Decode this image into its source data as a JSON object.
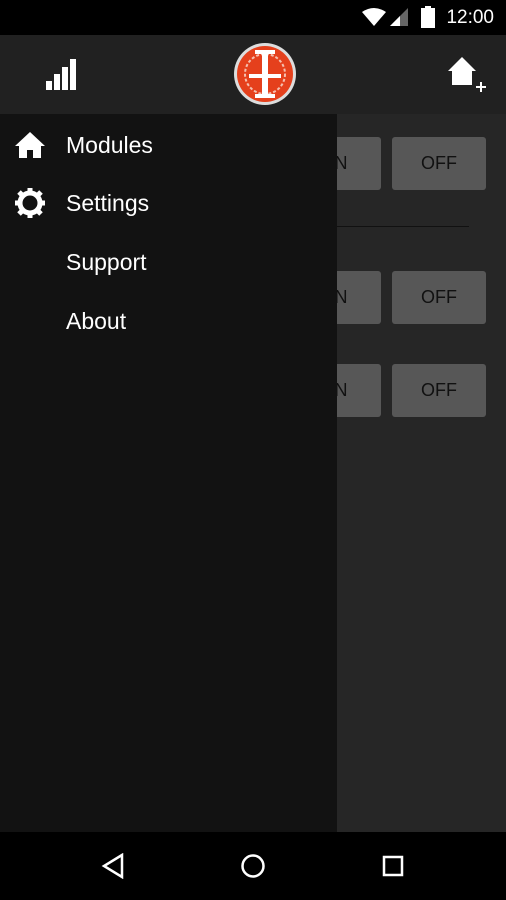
{
  "status_bar": {
    "time": "12:00",
    "icons": [
      "wifi-icon",
      "cell-signal-icon",
      "battery-icon"
    ]
  },
  "app_bar": {
    "left_icon": "signal-bars-icon",
    "logo": "IT",
    "right_icon": "add-home-icon"
  },
  "modules": [
    {
      "on_label": "ON",
      "off_label": "OFF"
    },
    {
      "on_label": "ON",
      "off_label": "OFF"
    },
    {
      "on_label": "ON",
      "off_label": "OFF"
    }
  ],
  "drawer": {
    "items": [
      {
        "label": "Modules",
        "icon": "home-icon"
      },
      {
        "label": "Settings",
        "icon": "gear-icon"
      },
      {
        "label": "Support"
      },
      {
        "label": "About"
      }
    ]
  },
  "nav_bar": {
    "icons": [
      "back-icon",
      "home-circle-icon",
      "recents-icon"
    ]
  },
  "colors": {
    "logo": "#e5401c",
    "drawer": "#121212",
    "button": "#575757"
  }
}
